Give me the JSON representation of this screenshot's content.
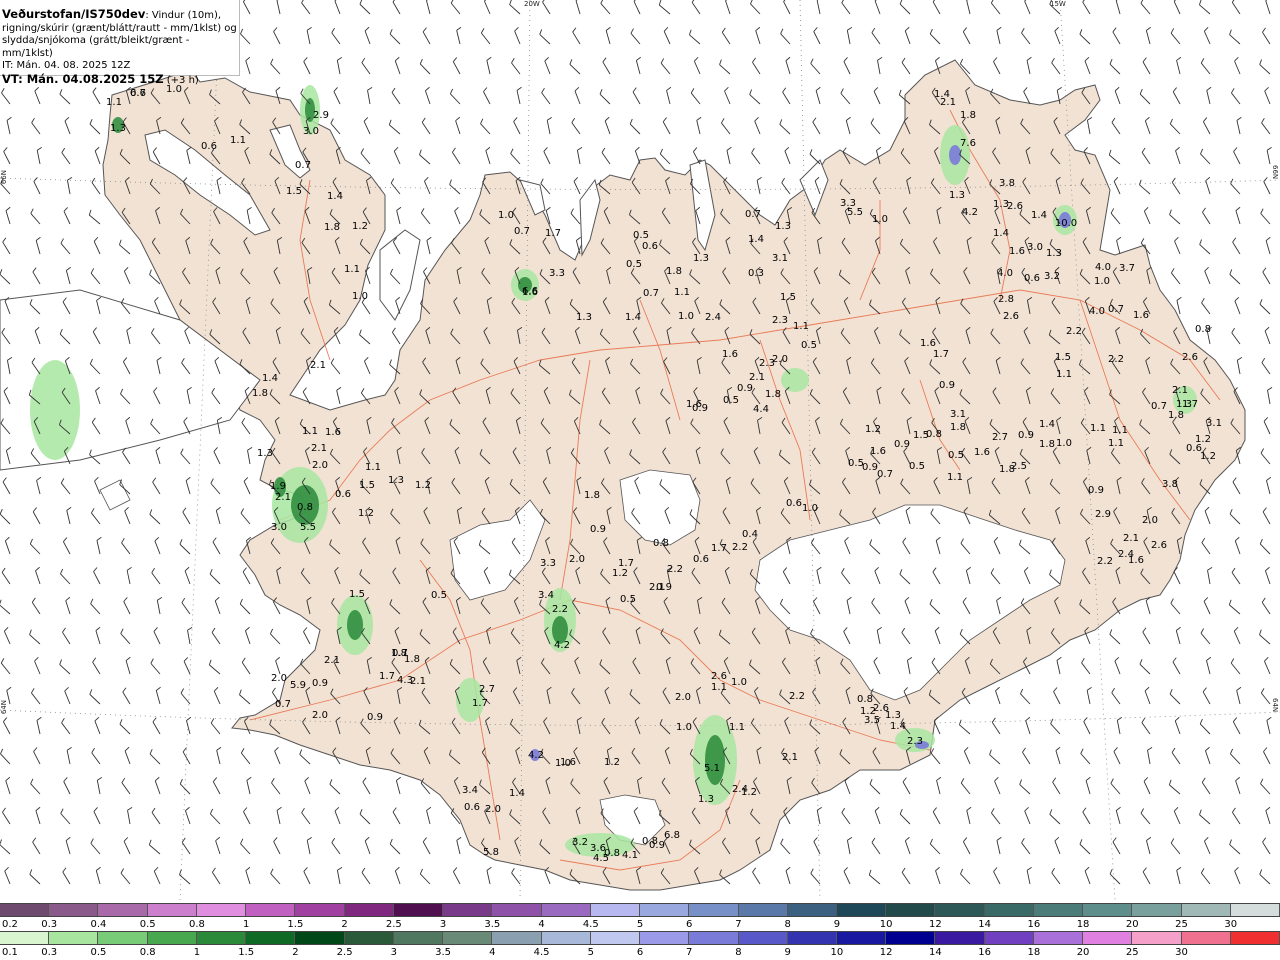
{
  "title": {
    "source": "Veðurstofan/IS750dev",
    "desc_line1": ": Vindur (10m),",
    "desc_line2": "rigning/skúrir (grænt/blátt/rautt - mm/1klst) og",
    "desc_line3": "slydda/snjókoma (grátt/bleikt/grænt - mm/1klst)",
    "it": "IT: Mán. 04. 08. 2025 12Z",
    "vt": "VT: Mán. 04.08.2025 15Z",
    "offset": " (+3 h)"
  },
  "axis_labels": {
    "lon_20w": "20W",
    "lon_15w": "15W",
    "lat_66n_left": "66N",
    "lat_66n_right": "66N",
    "lat_64n_left": "64N",
    "lat_64n_right": "64N"
  },
  "colors": {
    "land": "#f2e2d4",
    "ocean": "#ffffff",
    "glacier": "#ffffff",
    "roads": "#e8704a",
    "coast": "#555555",
    "wind_barb": "#333333",
    "grid": "#888888"
  },
  "legend": {
    "upper": {
      "labels": [
        "0.2",
        "0.3",
        "0.4",
        "0.5",
        "0.8",
        "1",
        "1.5",
        "2",
        "2.5",
        "3",
        "3.5",
        "4",
        "4.5",
        "5",
        "6",
        "7",
        "8",
        "9",
        "10",
        "12",
        "14",
        "16",
        "18",
        "20",
        "25",
        "30"
      ],
      "colors": [
        "#6e4a6e",
        "#8a5a8a",
        "#a86aa8",
        "#cc7fcc",
        "#e08ee0",
        "#c060c0",
        "#a040a0",
        "#802880",
        "#501050",
        "#7a3a8a",
        "#8e52a8",
        "#9a6ac0",
        "#b8b8f0",
        "#9aa8e0",
        "#7890c8",
        "#5a78a8",
        "#3c6080",
        "#1e4858",
        "#234a4a",
        "#2e5858",
        "#3a6a68",
        "#4c7c7a",
        "#5e8e8c",
        "#7aa09e",
        "#a0b8b6",
        "#d4dcdc"
      ]
    },
    "lower": {
      "labels": [
        "0.1",
        "0.3",
        "0.5",
        "0.8",
        "1",
        "1.5",
        "2",
        "2.5",
        "3",
        "3.5",
        "4",
        "4.5",
        "5",
        "6",
        "7",
        "8",
        "9",
        "10",
        "12",
        "14",
        "16",
        "18",
        "20",
        "25",
        "30"
      ],
      "colors": [
        "#d8f5d0",
        "#a8e6a0",
        "#78cc78",
        "#48a850",
        "#2a8a3a",
        "#0e6a24",
        "#004818",
        "#2a5a3a",
        "#507860",
        "#6a8a78",
        "#8aa0b0",
        "#a8b8d8",
        "#c0c8f0",
        "#9a9ae8",
        "#7a7ad8",
        "#5858c8",
        "#3434b0",
        "#1818a0",
        "#000090",
        "#3a1aa0",
        "#7040c0",
        "#a870d8",
        "#e080e0",
        "#f4a0c8",
        "#f07090",
        "#f03030"
      ]
    }
  },
  "value_labels": [
    "0.7",
    "1.0",
    "1.1",
    "1.3",
    "0.6",
    "1.1",
    "2.9",
    "3.0",
    "0.7",
    "1.5",
    "1.4",
    "1.8",
    "1.2",
    "1.1",
    "1.0",
    "1.0",
    "0.7",
    "1.7",
    "3.3",
    "6.6",
    "0.5",
    "0.6",
    "0.5",
    "1.8",
    "1.3",
    "0.7",
    "1.1",
    "1.3",
    "1.4",
    "1.0",
    "2.4",
    "0.7",
    "1.4",
    "1.3",
    "0.3",
    "3.1",
    "1.5",
    "2.3",
    "1.1",
    "0.5",
    "1.6",
    "2.3",
    "2.0",
    "2.1",
    "0.9",
    "1.8",
    "0.5",
    "5.5",
    "1.0",
    "3.3",
    "1.4",
    "2.1",
    "1.8",
    "7.6",
    "3.8",
    "4.2",
    "1.3",
    "2.6",
    "1.4",
    "1.4",
    "10.0",
    "1.3",
    "1.6",
    "3.0",
    "1.3",
    "3.2",
    "0.6",
    "4.0",
    "2.8",
    "2.6",
    "4.0",
    "3.7",
    "1.0",
    "4.0",
    "2.2",
    "0.7",
    "1.6",
    "0.8",
    "2.2",
    "1.1",
    "2.6",
    "1.6",
    "1.7",
    "0.9",
    "2.1",
    "1.3",
    "0.7",
    "1.8",
    "1.7",
    "3.1",
    "1.2",
    "0.6",
    "1.2",
    "3.8",
    "0.9",
    "2.9",
    "2.0",
    "2.1",
    "2.6",
    "2.2",
    "2.4",
    "1.6",
    "1.4",
    "2.1",
    "1.8",
    "1.9",
    "2.1",
    "3.0",
    "5.5",
    "0.6",
    "0.8",
    "1.2",
    "1.1",
    "1.3",
    "1.2",
    "1.5",
    "1.5",
    "0.5",
    "1.3",
    "1.1",
    "1.6",
    "2.1",
    "2.0",
    "0.7",
    "3.3",
    "3.4",
    "2.2",
    "4.2",
    "2.0",
    "0.9",
    "1.8",
    "1.7",
    "1.2",
    "0.5",
    "2.1",
    "2.2",
    "0.6",
    "1.7",
    "2.2",
    "0.4",
    "0.8",
    "0.9",
    "0.6",
    "1.0",
    "0.5",
    "1.6",
    "0.7",
    "0.5",
    "1.5",
    "0.9",
    "0.8",
    "0.5",
    "1.6",
    "1.8",
    "2.5",
    "3.1",
    "0.9",
    "1.8",
    "2.2",
    "0.8",
    "2.6",
    "1.3",
    "1.4",
    "2.3",
    "2.0",
    "0.7",
    "5.9",
    "2.1",
    "0.9",
    "1.7",
    "1.8",
    "1.8",
    "2.1",
    "2.0",
    "0.9",
    "4.3",
    "2.7",
    "1.7",
    "4.2",
    "1.6",
    "1.2",
    "1.0",
    "2.0",
    "2.6",
    "1.0",
    "1.1",
    "1.1",
    "5.1",
    "2.4",
    "1.3",
    "1.2",
    "1.0",
    "1.4",
    "3.4",
    "2.0",
    "0.6",
    "5.8",
    "3.2",
    "3.6",
    "4.5",
    "6.8",
    "0.9",
    "4.1",
    "0.8",
    "0.8",
    "1.2",
    "3.5",
    "2.1",
    "1.1",
    "0.9",
    "1.4",
    "1.0",
    "4.4",
    "0.9",
    "1.6",
    "1.5",
    "1.1",
    "1.1",
    "2.7",
    "1.2",
    "1.1",
    "1.8",
    "1.6",
    "6.6"
  ]
}
